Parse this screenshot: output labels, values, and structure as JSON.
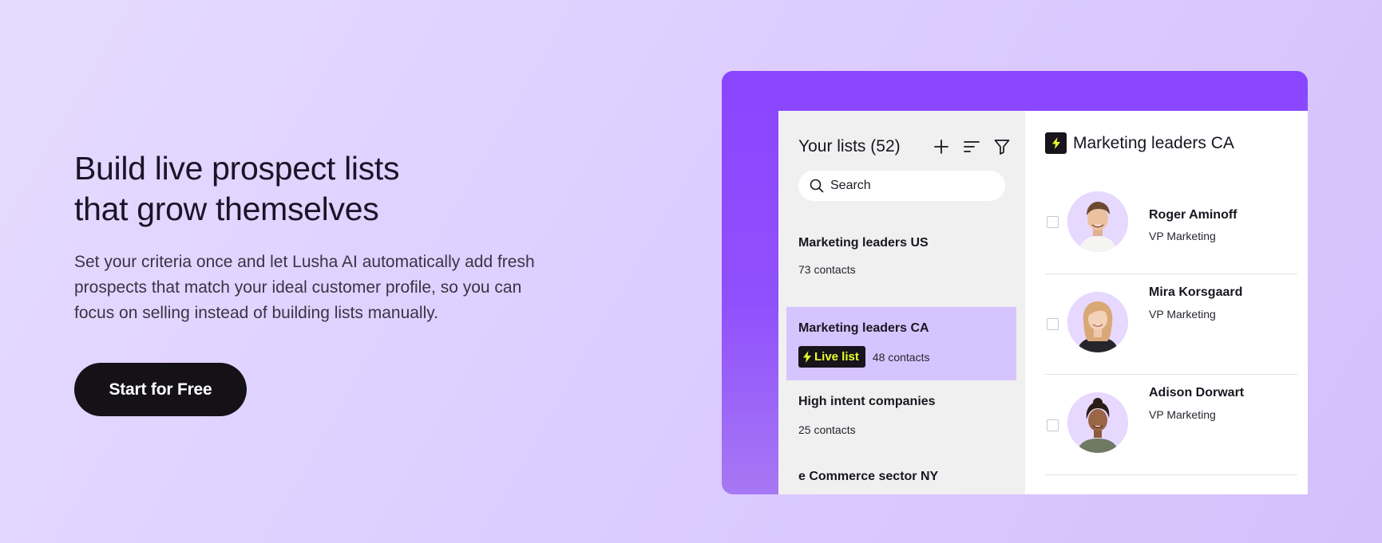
{
  "hero": {
    "headline_line1": "Build live prospect lists",
    "headline_line2": "that grow themselves",
    "subcopy_line1": "Set your criteria once and let Lusha AI automatically add fresh",
    "subcopy_line2": "prospects that match your ideal customer profile, so you can",
    "subcopy_line3": "focus on selling instead of building lists manually.",
    "cta_label": "Start for Free"
  },
  "lists_panel": {
    "title": "Your lists (52)",
    "icons": [
      "plus-icon",
      "sort-icon",
      "filter-icon"
    ],
    "search_placeholder": "Search",
    "items": [
      {
        "name": "Marketing leaders US",
        "count": "73 contacts",
        "active": false
      },
      {
        "name": "Marketing leaders CA",
        "badge": "Live list",
        "count_number": "48",
        "count_suffix": "contacts",
        "active": true
      },
      {
        "name": "High intent companies",
        "count": "25 contacts",
        "active": false
      },
      {
        "name": "e Commerce sector NY",
        "active": false
      }
    ]
  },
  "detail_panel": {
    "title": "Marketing leaders CA",
    "contacts": [
      {
        "name": "Roger Aminoff",
        "role": "VP Marketing"
      },
      {
        "name": "Mira Korsgaard",
        "role": "VP Marketing"
      },
      {
        "name": "Adison Dorwart",
        "role": "VP Marketing"
      }
    ]
  },
  "colors": {
    "accent_purple": "#8a45ff",
    "active_row": "#d6c4ff",
    "live_badge_text": "#eaff2a",
    "cta_bg": "#141217"
  }
}
